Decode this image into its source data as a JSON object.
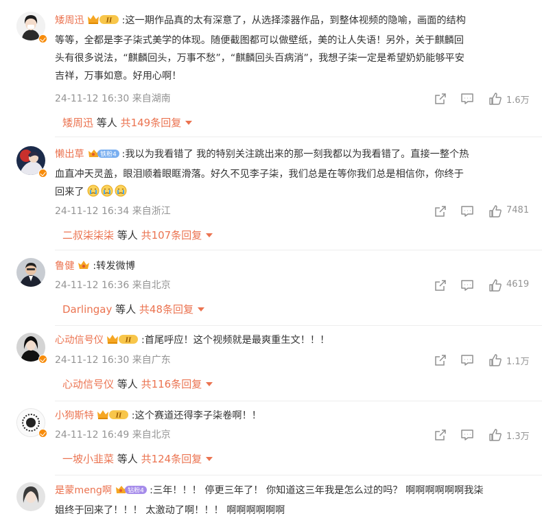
{
  "comments": [
    {
      "user": "矮周迅",
      "badge": "II",
      "lines": [
        ":这一期作品真的太有深意了，从选择漆器作品，到整体视频的隐喻，画面的结构",
        "等等，全都是李子柒式美学的体现。随便截图都可以做壁纸，美的让人失语！另外，关于麒麟回",
        "头有很多说法，“麒麟回头，万事不愁”，“麒麟回头百病消”，我想子柒一定是希望奶奶能够平安",
        "吉祥，万事如意。好用心啊！"
      ],
      "time": "24-11-12 16:30 来自湖南",
      "likes": "1.6万",
      "replies": {
        "name": "矮周迅",
        "mid": "等人",
        "count": "共149条回复"
      }
    },
    {
      "user": "懒出草",
      "badge": "铁粉4",
      "lines": [
        ":我以为我看错了 我的特别关注跳出来的那一刻我都以为我看错了。直接一整个热",
        "血直冲天灵盖，眼泪顺着眼眶滑落。好久不见李子柒，我们总是在等你我们总是相信你，你终于",
        "回来了"
      ],
      "emoji_count": 3,
      "time": "24-11-12 16:34 来自浙江",
      "likes": "7481",
      "replies": {
        "name": "二叔柒柒柒",
        "mid": "等人",
        "count": "共107条回复"
      }
    },
    {
      "user": "鲁健",
      "badge": "",
      "lines": [
        ":转发微博"
      ],
      "time": "24-11-12 16:36 来自北京",
      "likes": "4619",
      "replies": {
        "name": "Darlingay",
        "mid": "等人",
        "count": "共48条回复"
      }
    },
    {
      "user": "心动信号仪",
      "badge": "II",
      "lines": [
        ":首尾呼应！这个视频就是最爽重生文！！！"
      ],
      "time": "24-11-12 16:30 来自广东",
      "likes": "1.1万",
      "replies": {
        "name": "心动信号仪",
        "mid": "等人",
        "count": "共116条回复"
      }
    },
    {
      "user": "小狗斯特",
      "badge": "II",
      "lines": [
        ":这个赛道还得李子柒卷啊！！"
      ],
      "time": "24-11-12 16:49 来自北京",
      "likes": "1.3万",
      "replies": {
        "name": "一坡小韭菜",
        "mid": "等人",
        "count": "共124条回复"
      }
    },
    {
      "user": "是蒙meng啊",
      "badge": "钻粉4",
      "lines": [
        ":三年！！！ 停更三年了！ 你知道这三年我是怎么过的吗？ 啊啊啊啊啊啊我柒",
        "姐终于回来了！！！ 太激动了啊！！！ 啊啊啊啊啊啊"
      ]
    }
  ],
  "icons": {
    "share": "share-icon",
    "comment": "comment-icon",
    "like": "like-icon",
    "verified": "verified-badge-icon",
    "crown": "crown-icon"
  },
  "colors": {
    "username": "#eb7350",
    "meta": "#939393",
    "verified": "#f78b0a",
    "fan_badge": "#64b5f6"
  }
}
